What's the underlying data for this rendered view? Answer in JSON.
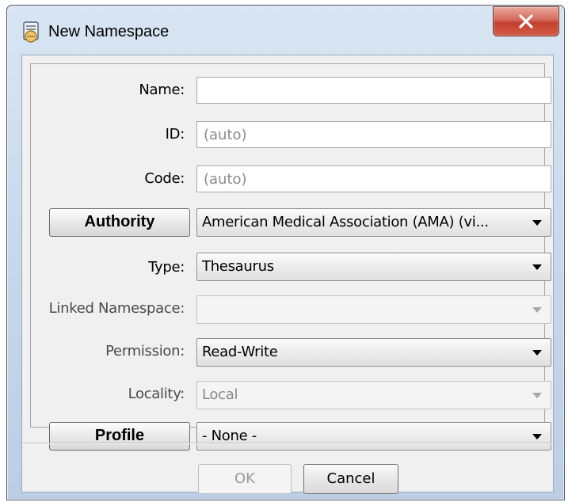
{
  "dialog": {
    "title": "New Namespace",
    "close_label": "X"
  },
  "form": {
    "name": {
      "label": "Name:",
      "value": ""
    },
    "id": {
      "label": "ID:",
      "value": "(auto)"
    },
    "code": {
      "label": "Code:",
      "value": "(auto)"
    },
    "authority": {
      "button_label": "Authority",
      "selected": "American Medical Association (AMA) (vi..."
    },
    "type": {
      "label": "Type:",
      "selected": "Thesaurus"
    },
    "linked_namespace": {
      "label": "Linked Namespace:",
      "selected": ""
    },
    "permission": {
      "label": "Permission:",
      "selected": "Read-Write"
    },
    "locality": {
      "label": "Locality:",
      "selected": "Local"
    },
    "profile": {
      "button_label": "Profile",
      "selected": "- None -"
    }
  },
  "footer": {
    "ok_label": "OK",
    "cancel_label": "Cancel"
  },
  "icons": {
    "title": "namespace-app-icon",
    "close": "close-icon",
    "dropdown": "chevron-down-icon"
  },
  "colors": {
    "close_button": "#c94a39",
    "titlebar": "#c9d9ec",
    "panel": "#f0f0f0"
  }
}
